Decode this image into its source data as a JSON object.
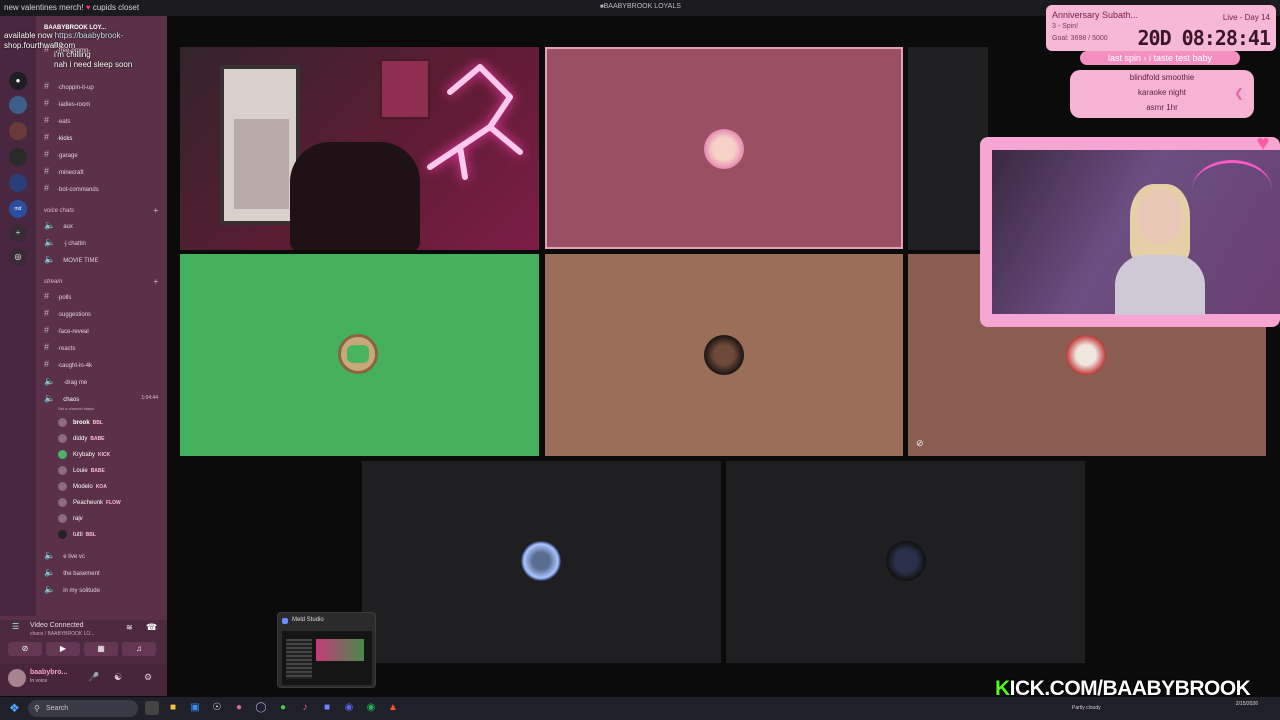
{
  "topbar": {
    "ticker_prefix": "",
    "ticker_highlight": "",
    "ticker_text": "new valentines merch!",
    "ticker_suffix": "cupids closet",
    "ticker_line2": "available now",
    "ticker_line2_link": "https://baabybrook-",
    "ticker_line3": "shop.fourthwall.com",
    "window_title": "BAABYBROOK LOYALS"
  },
  "chat": [
    {
      "user": "",
      "text": "no"
    },
    {
      "user": "",
      "text": "i'm chilling"
    },
    {
      "user": "",
      "text": "nah i need sleep soon"
    }
  ],
  "server_header": "BAABYBROOK LOY...",
  "channels": [
    {
      "label": "-free-promo-",
      "type": "text"
    },
    {
      "label": "·choppin-it-up",
      "type": "text"
    },
    {
      "label": "·ladies-room",
      "type": "text"
    },
    {
      "label": "·eats",
      "type": "text"
    },
    {
      "label": "·kicks",
      "type": "text",
      "bold": true
    },
    {
      "label": "·garage",
      "type": "text"
    },
    {
      "label": "·minecraft",
      "type": "text"
    },
    {
      "label": "·bot-commands",
      "type": "text"
    },
    {
      "label": "voice chats",
      "type": "category"
    },
    {
      "label": "aux",
      "type": "voice"
    },
    {
      "label": "·j chattin",
      "type": "voice"
    },
    {
      "label": "MOVIE TIME",
      "type": "voice"
    },
    {
      "label": "stream",
      "type": "category"
    },
    {
      "label": "·polls",
      "type": "text"
    },
    {
      "label": "·suggestions",
      "type": "text"
    },
    {
      "label": "·face-reveal",
      "type": "text"
    },
    {
      "label": "·reacts",
      "type": "text"
    },
    {
      "label": "·caught-in-4k",
      "type": "text"
    },
    {
      "label": "·drag me",
      "type": "voice"
    },
    {
      "label": "chaos",
      "type": "voice",
      "active": true,
      "time": "1:04:44"
    }
  ],
  "channel_status_hint": "Set a channel status",
  "members": [
    {
      "name": "brook",
      "badge": "BBL",
      "bold": true
    },
    {
      "name": "diddy",
      "badge": "BABE"
    },
    {
      "name": "Krybaby",
      "badge": "KICK"
    },
    {
      "name": "Louie",
      "badge": "BABE"
    },
    {
      "name": "Modelo",
      "badge": "KOA"
    },
    {
      "name": "Peacheunk",
      "badge": "FLOW"
    },
    {
      "name": "rajv",
      "badge": ""
    },
    {
      "name": "tutti",
      "badge": "BBL"
    }
  ],
  "channels_after": [
    {
      "label": "e live vc",
      "type": "voice"
    },
    {
      "label": "the basement",
      "type": "voice"
    },
    {
      "label": "in my solitude",
      "type": "voice"
    }
  ],
  "voice_panel": {
    "status": "Video Connected",
    "subtitle": "chaos / BAABYBROOK LO..."
  },
  "user": {
    "name": "baabybro...",
    "status": "In voice"
  },
  "subathon": {
    "title": "Anniversary Subath...",
    "line2": "Spin!",
    "goal": "Goal: 3698 / 5000",
    "live": "Live - Day 14",
    "timer": "20D 08:28:41"
  },
  "spin_pill": {
    "label": "last spin",
    "value": "i taste test baby"
  },
  "wheel": [
    "blindfold smoothie",
    "karaoke night",
    "asmr 1hr"
  ],
  "meld": {
    "title": "Meld Studio"
  },
  "kick": {
    "label": "KICK.COM/BAABYBROOK"
  },
  "taskbar": {
    "search_placeholder": "Search",
    "weather": "Partly cloudy",
    "time": "",
    "date": "2/15/2026"
  },
  "colors": {
    "sidebar": "#5a3148",
    "tile_pink": "#9b4f63",
    "tile_green": "#46b15c",
    "tile_tan": "#9b6e5a",
    "tile_brown": "#8b5d52",
    "tile_dark": "#1f1f21",
    "kick_green": "#53fc18",
    "accent_pink": "#f7b7d6"
  }
}
